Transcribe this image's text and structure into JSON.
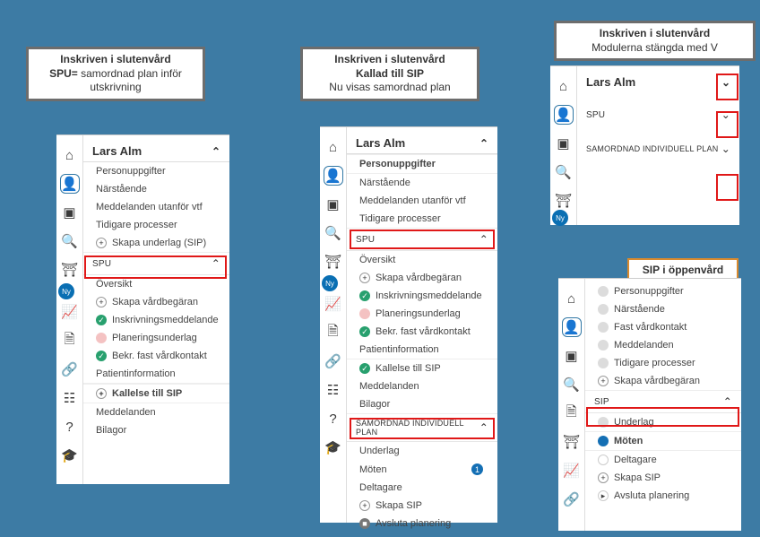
{
  "captions": {
    "c1_l1": "Inskriven i slutenvård",
    "c1_spu": "SPU=",
    "c1_l2": " samordnad plan inför utskrivning",
    "c2_l1": "Inskriven i slutenvård",
    "c2_l2": "Kallad till SIP",
    "c2_l3": "Nu visas samordnad plan",
    "c3_l1": "Inskriven i slutenvård",
    "c3_l2": "Modulerna stängda med  V",
    "c4": "SIP i öppenvård"
  },
  "common": {
    "patient": "Lars Alm",
    "ny": "Ny",
    "personuppgifter": "Personuppgifter",
    "narstaende": "Närstående",
    "medd_utanfor": "Meddelanden utanför vtf",
    "tidigare": "Tidigare processer",
    "skapa_underlag": "Skapa underlag (SIP)",
    "spu": "SPU",
    "oversikt": "Översikt",
    "skapa_vard": "Skapa vårdbegäran",
    "inskrivning": "Inskrivningsmeddelande",
    "planering": "Planeringsunderlag",
    "bekr_fast": "Bekr. fast vårdkontakt",
    "patientinfo": "Patientinformation",
    "kallelse": "Kallelse till SIP",
    "meddelanden": "Meddelanden",
    "bilagor": "Bilagor",
    "samordnad": "SAMORDNAD INDIVIDUELL PLAN",
    "underlag": "Underlag",
    "moten": "Möten",
    "deltagare": "Deltagare",
    "skapa_sip": "Skapa SIP",
    "avsluta": "Avsluta planering",
    "fast_vard": "Fast vårdkontakt",
    "sip": "SIP"
  },
  "panel2": {
    "moten_count": "1"
  }
}
